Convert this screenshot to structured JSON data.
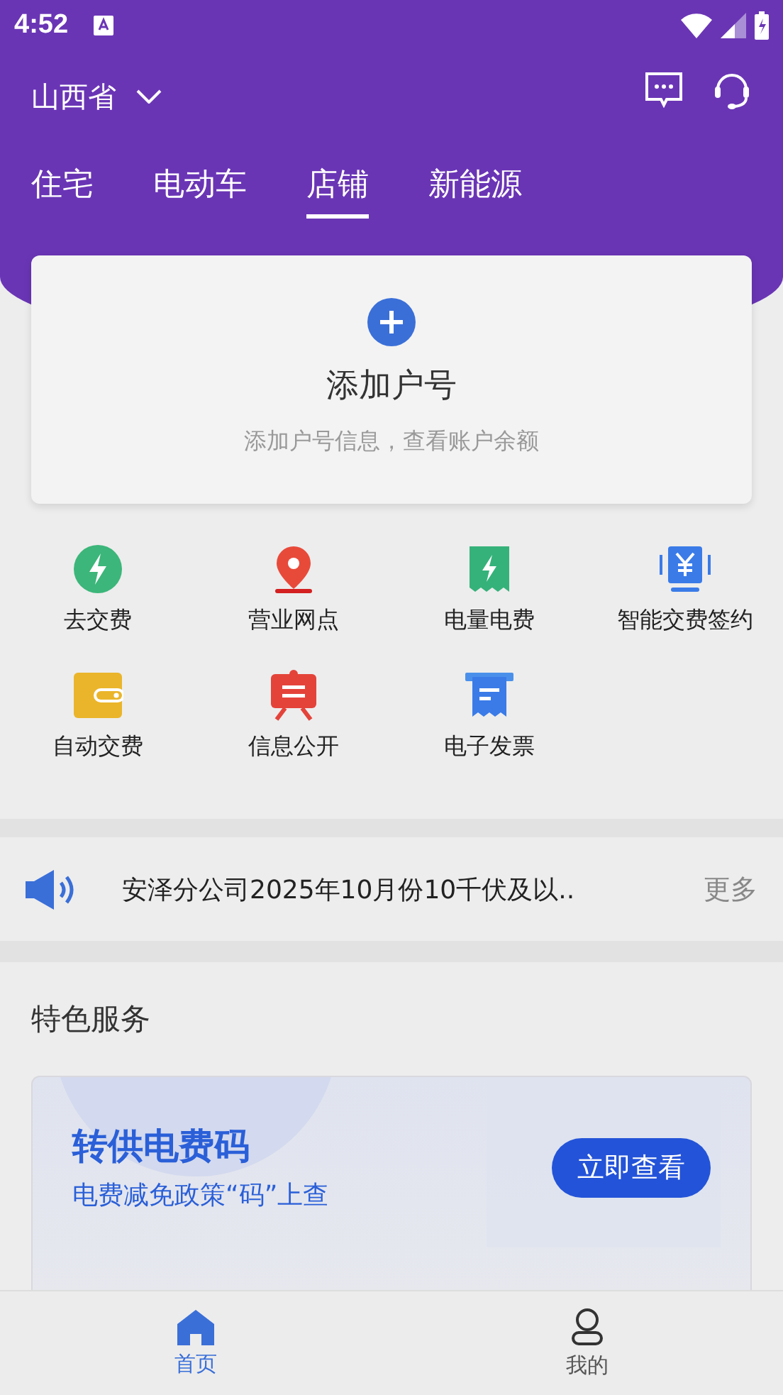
{
  "status_bar": {
    "time": "4:52"
  },
  "header": {
    "region": "山西省"
  },
  "tabs": [
    {
      "label": "住宅",
      "selected": false
    },
    {
      "label": "电动车",
      "selected": false
    },
    {
      "label": "店铺",
      "selected": true
    },
    {
      "label": "新能源",
      "selected": false
    }
  ],
  "account_card": {
    "title": "添加户号",
    "subtitle": "添加户号信息，查看账户余额"
  },
  "services": [
    {
      "label": "去交费",
      "kind": "bolt"
    },
    {
      "label": "营业网点",
      "kind": "pin"
    },
    {
      "label": "电量电费",
      "kind": "bill"
    },
    {
      "label": "智能交费签约",
      "kind": "yuan"
    },
    {
      "label": "自动交费",
      "kind": "wallet"
    },
    {
      "label": "信息公开",
      "kind": "board"
    },
    {
      "label": "电子发票",
      "kind": "receipt"
    }
  ],
  "notice": {
    "text": "安泽分公司2025年10月份10千伏及以..",
    "more": "更多"
  },
  "featured": {
    "title": "特色服务",
    "banner": {
      "title": "转供电费码",
      "subtitle": "电费减免政策“码”上查",
      "button": "立即查看"
    }
  },
  "bottom_nav": [
    {
      "label": "首页",
      "selected": true
    },
    {
      "label": "我的",
      "selected": false
    }
  ]
}
